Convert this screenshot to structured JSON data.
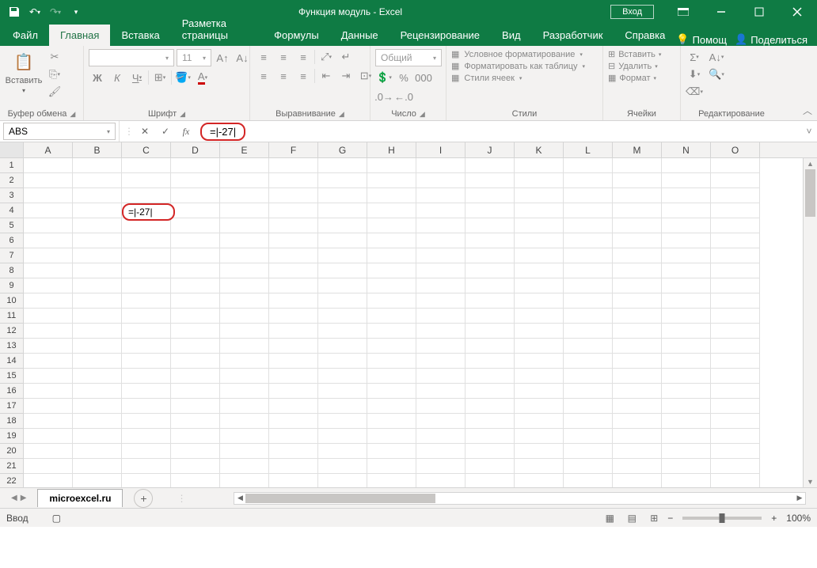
{
  "title": "Функция модуль  -  Excel",
  "signin": "Вход",
  "tabs": [
    "Файл",
    "Главная",
    "Вставка",
    "Разметка страницы",
    "Формулы",
    "Данные",
    "Рецензирование",
    "Вид",
    "Разработчик",
    "Справка"
  ],
  "active_tab": 1,
  "help": "Помощ",
  "share": "Поделиться",
  "ribbon": {
    "clipboard": {
      "paste": "Вставить",
      "label": "Буфер обмена"
    },
    "font": {
      "name": "",
      "size": "11",
      "label": "Шрифт",
      "buttons": {
        "bold": "Ж",
        "italic": "К",
        "underline": "Ч"
      }
    },
    "align": {
      "label": "Выравнивание"
    },
    "number": {
      "format": "Общий",
      "label": "Число"
    },
    "styles": {
      "cond": "Условное форматирование",
      "table": "Форматировать как таблицу",
      "cell": "Стили ячеек",
      "label": "Стили"
    },
    "cells": {
      "insert": "Вставить",
      "delete": "Удалить",
      "format": "Формат",
      "label": "Ячейки"
    },
    "editing": {
      "label": "Редактирование"
    }
  },
  "namebox": "ABS",
  "formula": "=|-27|",
  "cell_value": "=|-27|",
  "columns": [
    "A",
    "B",
    "C",
    "D",
    "E",
    "F",
    "G",
    "H",
    "I",
    "J",
    "K",
    "L",
    "M",
    "N",
    "O"
  ],
  "rows": [
    "1",
    "2",
    "3",
    "4",
    "5",
    "6",
    "7",
    "8",
    "9",
    "10",
    "11",
    "12",
    "13",
    "14",
    "15",
    "16",
    "17",
    "18",
    "19",
    "20",
    "21",
    "22"
  ],
  "sheet": "microexcel.ru",
  "status": "Ввод",
  "zoom": "100%"
}
